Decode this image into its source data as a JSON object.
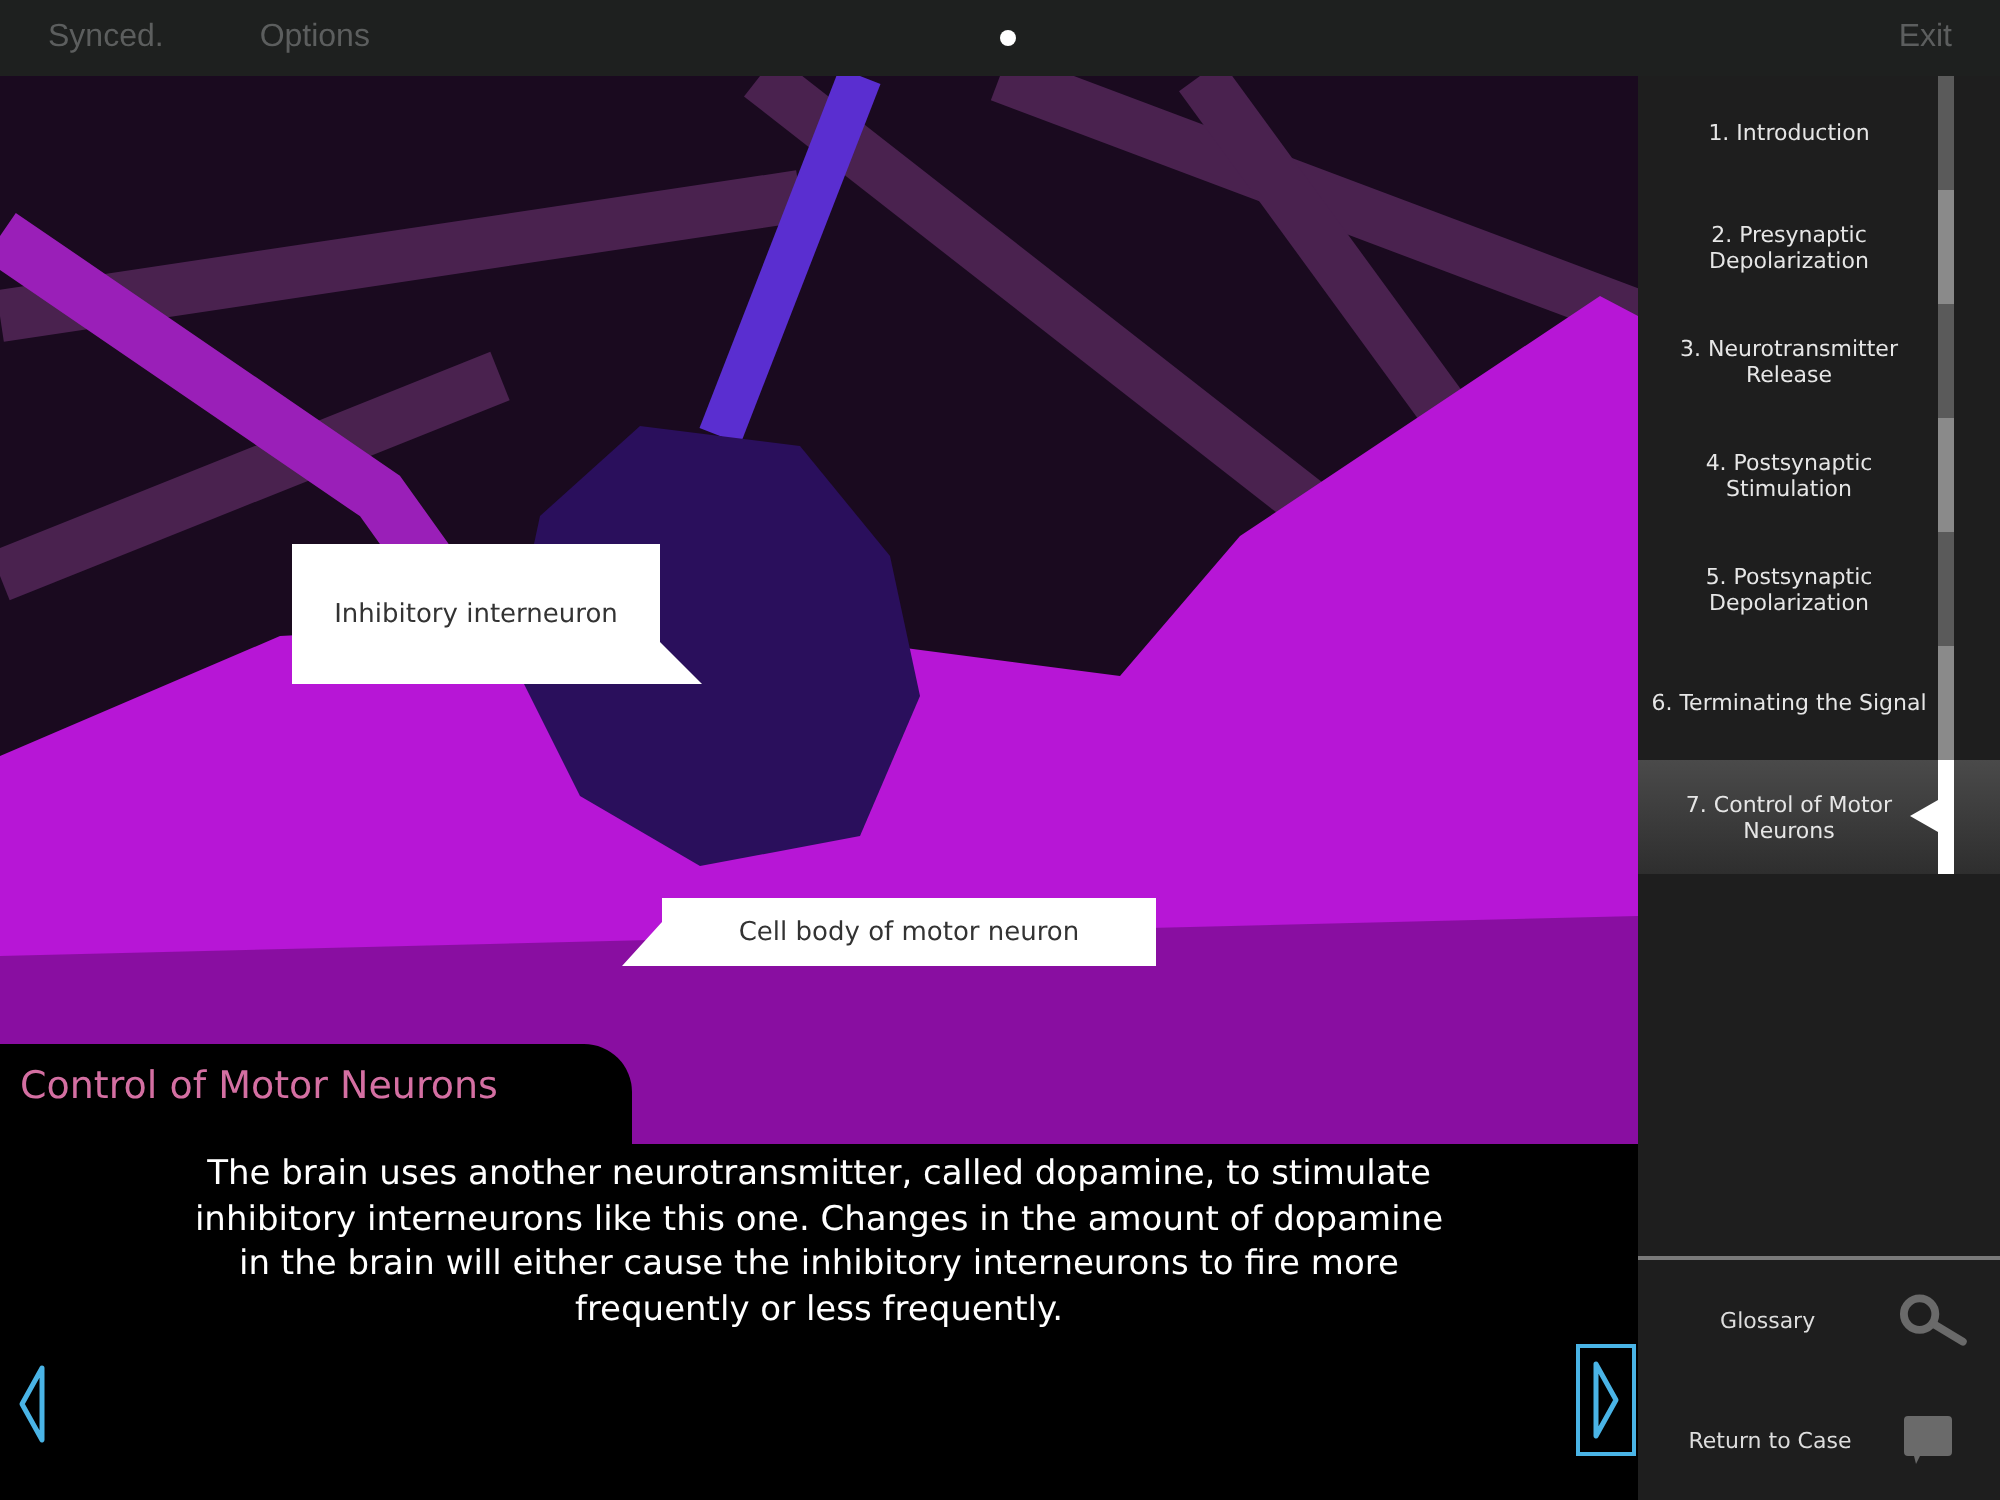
{
  "top_bar": {
    "status": "Synced.",
    "options": "Options",
    "exit": "Exit"
  },
  "scene": {
    "callouts": [
      {
        "text": "Inhibitory interneuron",
        "kind": "pointer-right"
      },
      {
        "text": "Cell body of motor neuron",
        "kind": "pointer-left"
      }
    ]
  },
  "section_title": "Control of Motor Neurons",
  "narration": "The brain uses another neurotransmitter, called dopamine, to stimulate inhibitory interneurons like this one. Changes in the amount of dopamine in the brain will either cause the inhibitory interneurons to fire more frequently or less frequently.",
  "chapters": [
    {
      "label": "1. Introduction",
      "selected": false
    },
    {
      "label": "2. Presynaptic Depolarization",
      "selected": false
    },
    {
      "label": "3. Neurotransmitter Release",
      "selected": false
    },
    {
      "label": "4. Postsynaptic Stimulation",
      "selected": false
    },
    {
      "label": "5. Postsynaptic Depolarization",
      "selected": false
    },
    {
      "label": "6. Terminating the Signal",
      "selected": false
    },
    {
      "label": "7. Control of Motor Neurons",
      "selected": true
    }
  ],
  "tools": [
    {
      "label": "Glossary",
      "kind": "search"
    },
    {
      "label": "Return to Case",
      "kind": "case"
    }
  ]
}
